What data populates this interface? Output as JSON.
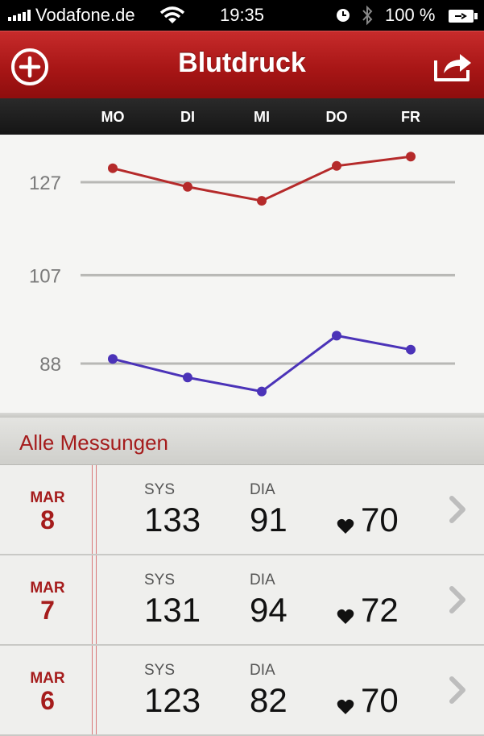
{
  "status_bar": {
    "carrier": "Vodafone.de",
    "time": "19:35",
    "battery_percent": "100 %",
    "icons": [
      "signal-bars-icon",
      "wifi-icon",
      "alarm-icon",
      "bluetooth-icon",
      "battery-charging-icon"
    ]
  },
  "nav": {
    "title": "Blutdruck",
    "left_icon": "plus-circle-icon",
    "right_icon": "share-icon"
  },
  "days": [
    "MO",
    "DI",
    "MI",
    "DO",
    "FR"
  ],
  "chart_data": {
    "type": "line",
    "categories": [
      "MO",
      "DI",
      "MI",
      "DO",
      "FR"
    ],
    "y_ticks": [
      "127",
      "107",
      "88"
    ],
    "ylim": [
      84,
      140
    ],
    "grid": true,
    "series": [
      {
        "color": "#b52a2a",
        "values": [
          130,
          126,
          123,
          130.5,
          132.5
        ]
      },
      {
        "color": "#4b33b8",
        "values": [
          89,
          85,
          82,
          94,
          91
        ]
      }
    ]
  },
  "section": {
    "title": "Alle Messungen"
  },
  "labels": {
    "sys": "SYS",
    "dia": "DIA"
  },
  "measurements": [
    {
      "month": "MAR",
      "day": "8",
      "sys": "133",
      "dia": "91",
      "pulse": "70"
    },
    {
      "month": "MAR",
      "day": "7",
      "sys": "131",
      "dia": "94",
      "pulse": "72"
    },
    {
      "month": "MAR",
      "day": "6",
      "sys": "123",
      "dia": "82",
      "pulse": "70"
    }
  ],
  "colors": {
    "accent": "#a51c1c",
    "nav_red": "#b41d1d"
  }
}
